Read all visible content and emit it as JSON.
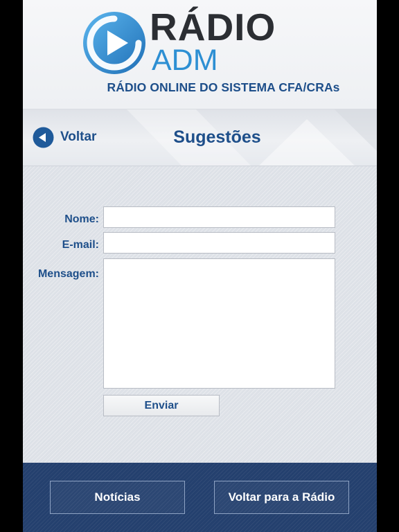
{
  "header": {
    "logo_main": "RÁDIO",
    "logo_sub": "ADM",
    "tagline": "RÁDIO ONLINE DO SISTEMA CFA/CRAs"
  },
  "nav": {
    "back_label": "Voltar",
    "title": "Sugestões"
  },
  "form": {
    "name_label": "Nome:",
    "name_value": "",
    "email_label": "E-mail:",
    "email_value": "",
    "message_label": "Mensagem:",
    "message_value": "",
    "submit_label": "Enviar"
  },
  "footer": {
    "news_label": "Notícias",
    "back_to_radio_label": "Voltar para a Rádio"
  },
  "colors": {
    "brand_blue": "#1e4f8a",
    "logo_light_blue": "#2d8fd3",
    "footer_navy": "#24406e"
  },
  "icons": {
    "logo": "play-circle-icon",
    "back": "back-arrow-circle-icon"
  }
}
